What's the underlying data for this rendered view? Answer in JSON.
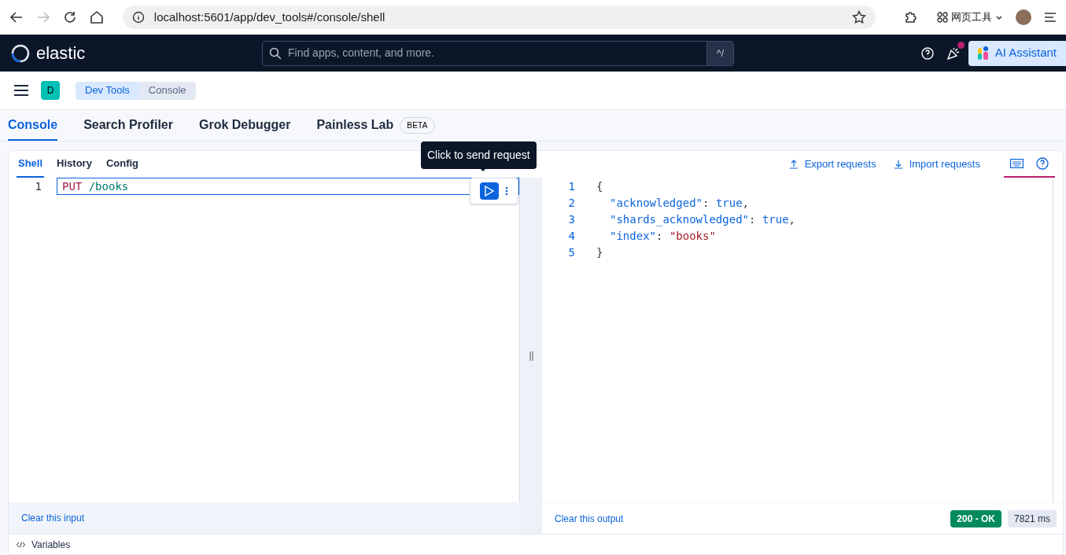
{
  "browser": {
    "url": "localhost:5601/app/dev_tools#/console/shell",
    "toolbar_label": "网页工具"
  },
  "header": {
    "logo": "elastic",
    "search": {
      "placeholder": "Find apps, content, and more.",
      "shortcut": "^/"
    },
    "notification": true,
    "assistant": "AI Assistant"
  },
  "space": "D",
  "breadcrumbs": [
    {
      "label": "Dev Tools",
      "selected": false
    },
    {
      "label": "Console",
      "selected": true
    }
  ],
  "tabs": [
    {
      "label": "Console",
      "selected": true
    },
    {
      "label": "Search Profiler",
      "selected": false
    },
    {
      "label": "Grok Debugger",
      "selected": false
    },
    {
      "label": "Painless Lab",
      "selected": false,
      "badge": "BETA"
    }
  ],
  "subtabs": [
    {
      "label": "Shell",
      "selected": true
    },
    {
      "label": "History",
      "selected": false
    },
    {
      "label": "Config",
      "selected": false
    }
  ],
  "actions": [
    "Export requests",
    "Import requests"
  ],
  "tooltip": "Click to send request",
  "input": {
    "lines": [
      {
        "number": "1",
        "tokens": [
          {
            "text": "PUT",
            "kind": "method"
          },
          {
            "text": "/books",
            "kind": "path"
          }
        ]
      }
    ]
  },
  "output": {
    "lines": [
      {
        "number": "1",
        "tokens": [
          {
            "text": "{",
            "kind": "punct"
          }
        ]
      },
      {
        "number": "2",
        "indented": true,
        "tokens": [
          {
            "text": "\"acknowledged\"",
            "kind": "key"
          },
          {
            "text": ": ",
            "kind": "punct"
          },
          {
            "text": "true",
            "kind": "bool"
          },
          {
            "text": ",",
            "kind": "punct"
          }
        ]
      },
      {
        "number": "3",
        "indented": true,
        "tokens": [
          {
            "text": "\"shards_acknowledged\"",
            "kind": "key"
          },
          {
            "text": ": ",
            "kind": "punct"
          },
          {
            "text": "true",
            "kind": "bool"
          },
          {
            "text": ",",
            "kind": "punct"
          }
        ]
      },
      {
        "number": "4",
        "indented": true,
        "tokens": [
          {
            "text": "\"index\"",
            "kind": "key"
          },
          {
            "text": ": ",
            "kind": "punct"
          },
          {
            "text": "\"books\"",
            "kind": "string"
          }
        ]
      },
      {
        "number": "5",
        "tokens": [
          {
            "text": "}",
            "kind": "punct"
          }
        ]
      }
    ]
  },
  "clear_input": "Clear this input",
  "clear_output": "Clear this output",
  "status": "200 - OK",
  "duration": "7821 ms",
  "variables": "Variables"
}
